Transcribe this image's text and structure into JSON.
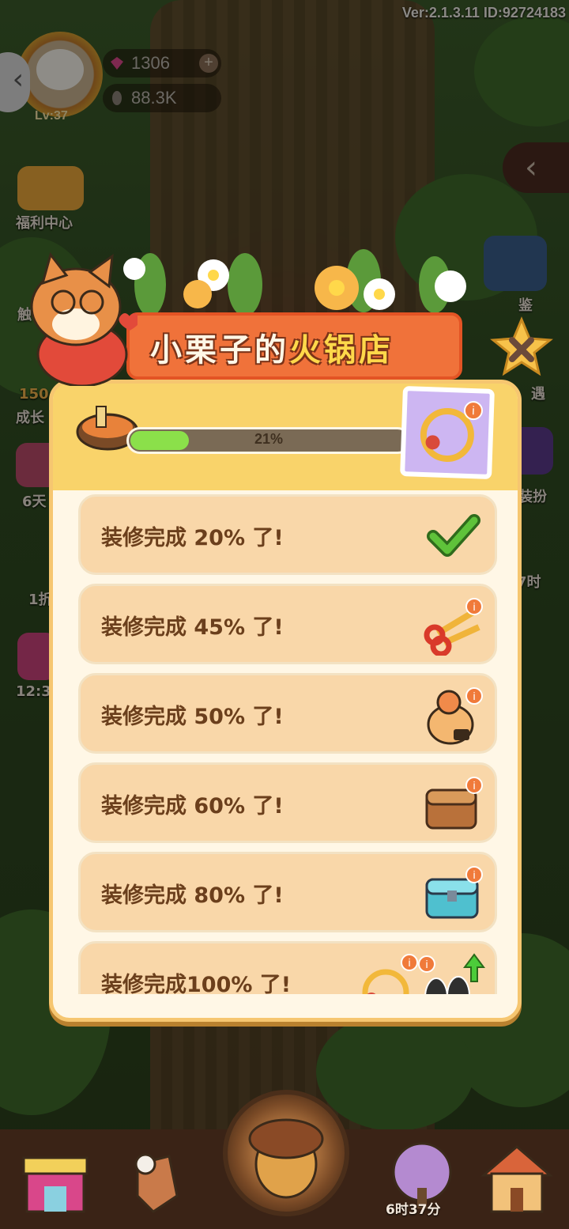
{
  "version": "Ver:2.1.3.11 ID:92724183",
  "player": {
    "level": "Lv:37",
    "gems": "1306",
    "acorns": "88.3K"
  },
  "side_labels": {
    "welfare": "福利中心",
    "left2": "触",
    "left3": "成长",
    "left3_num": "150",
    "left4": "6天",
    "left5": "1折",
    "left6": "12:3",
    "right1": "鉴",
    "right2": "遇",
    "right3": "装扮",
    "right4": "7时"
  },
  "panel": {
    "title_part1": "小栗子的",
    "title_part2": "火锅店",
    "progress_label": "21%",
    "progress_value": 0.21
  },
  "milestones": [
    {
      "label": "装修完成 20% 了!",
      "reward": "check-icon"
    },
    {
      "label": "装修完成 45% 了!",
      "reward": "scissors-icon"
    },
    {
      "label": "装修完成 50% 了!",
      "reward": "octopus-bag-icon"
    },
    {
      "label": "装修完成 60% 了!",
      "reward": "wooden-chest-icon"
    },
    {
      "label": "装修完成 80% 了!",
      "reward": "blue-chest-icon"
    },
    {
      "label": "装修完成100% 了!",
      "reward": "bracelet-and-seeds-icon"
    }
  ],
  "bottom_bar": {
    "timer": "6时37分"
  },
  "colors": {
    "accent": "#f0723a",
    "progress": "#8be04a",
    "row": "#f9d7a9",
    "text": "#6b3f1c"
  }
}
